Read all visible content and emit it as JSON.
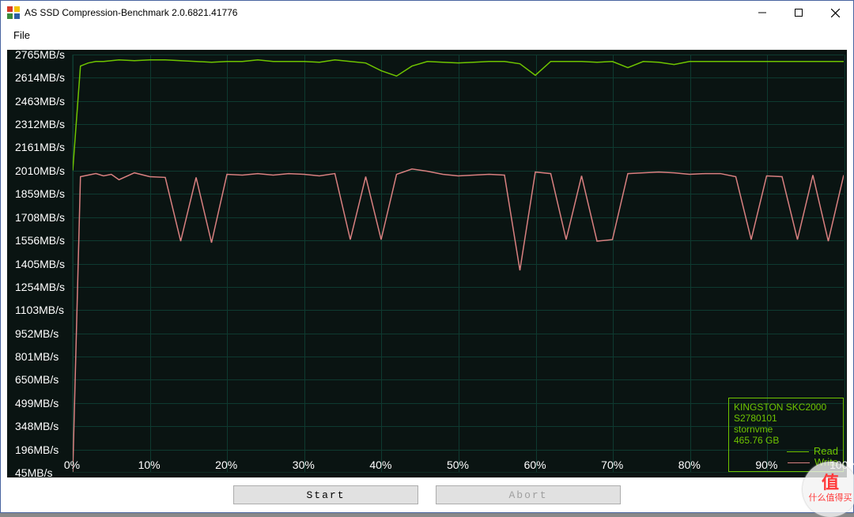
{
  "window": {
    "title": "AS SSD Compression-Benchmark 2.0.6821.41776"
  },
  "menu": {
    "file": "File"
  },
  "buttons": {
    "start": "Start",
    "abort": "Abort"
  },
  "legend": {
    "line1": "KINGSTON SKC2000",
    "line2": "S2780101",
    "line3": "stornvme",
    "line4": "465.76 GB",
    "read": "Read",
    "write": "Write"
  },
  "watermark": {
    "char": "值",
    "text": "什么值得买"
  },
  "chart_data": {
    "type": "line",
    "xlabel": "",
    "ylabel": "",
    "x_unit": "%",
    "y_unit": "MB/s",
    "ylim": [
      45,
      2765
    ],
    "xlim": [
      0,
      100
    ],
    "y_ticks": [
      2765,
      2614,
      2463,
      2312,
      2161,
      2010,
      1859,
      1708,
      1556,
      1405,
      1254,
      1103,
      952,
      801,
      650,
      499,
      348,
      196,
      45
    ],
    "x_ticks": [
      0,
      10,
      20,
      30,
      40,
      50,
      60,
      70,
      80,
      90,
      100
    ],
    "categories_pct": [
      0,
      1,
      2,
      3,
      4,
      5,
      6,
      8,
      10,
      12,
      14,
      16,
      18,
      20,
      22,
      24,
      26,
      28,
      30,
      32,
      34,
      36,
      38,
      40,
      42,
      44,
      46,
      48,
      50,
      52,
      54,
      56,
      58,
      60,
      62,
      64,
      66,
      68,
      70,
      72,
      74,
      76,
      78,
      80,
      82,
      84,
      86,
      88,
      90,
      92,
      94,
      96,
      98,
      100
    ],
    "series": [
      {
        "name": "Read",
        "color": "#6fc400",
        "values": [
          2010,
          2690,
          2710,
          2720,
          2720,
          2725,
          2730,
          2725,
          2730,
          2730,
          2725,
          2720,
          2715,
          2720,
          2720,
          2730,
          2720,
          2720,
          2720,
          2715,
          2730,
          2720,
          2710,
          2660,
          2625,
          2690,
          2720,
          2715,
          2710,
          2715,
          2720,
          2720,
          2705,
          2630,
          2720,
          2720,
          2720,
          2715,
          2720,
          2680,
          2720,
          2715,
          2700,
          2720,
          2720,
          2720,
          2720,
          2720,
          2720,
          2720,
          2720,
          2720,
          2720,
          2720
        ]
      },
      {
        "name": "Write",
        "color": "#d98080",
        "values": [
          45,
          1970,
          1980,
          1990,
          1975,
          1985,
          1950,
          1995,
          1970,
          1965,
          1550,
          1965,
          1540,
          1985,
          1980,
          1990,
          1980,
          1990,
          1985,
          1975,
          1990,
          1560,
          1970,
          1560,
          1985,
          2020,
          2005,
          1985,
          1975,
          1980,
          1985,
          1980,
          1360,
          2000,
          1990,
          1560,
          1975,
          1550,
          1560,
          1990,
          1995,
          2000,
          1995,
          1985,
          1990,
          1990,
          1970,
          1560,
          1975,
          1970,
          1560,
          1980,
          1550,
          1980
        ]
      }
    ]
  }
}
